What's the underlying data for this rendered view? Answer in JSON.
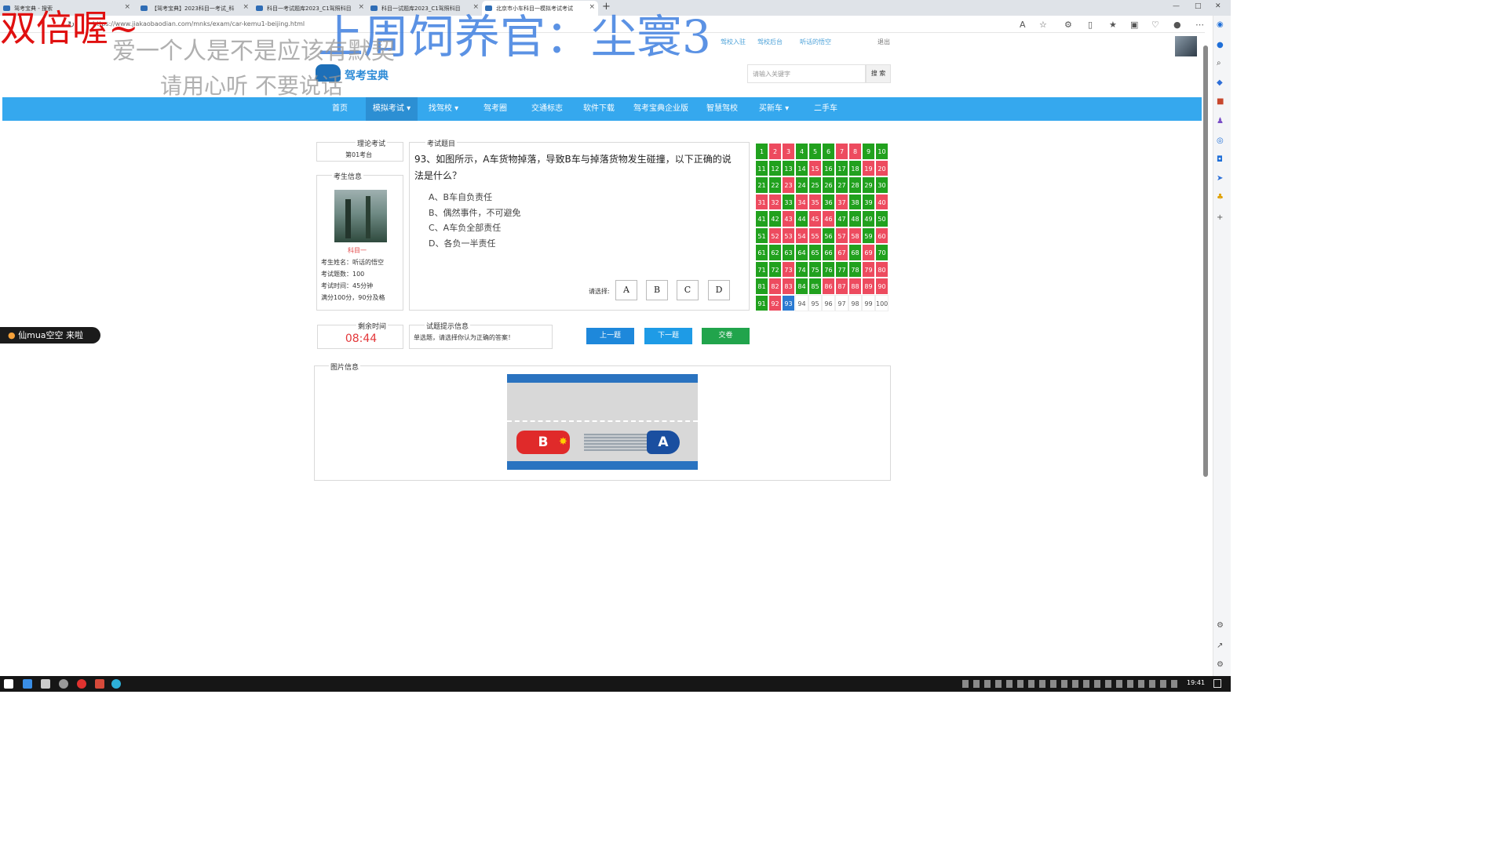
{
  "browser": {
    "tabs": [
      {
        "label": "驾考宝典 - 搜索"
      },
      {
        "label": "【驾考宝典】2023科目一考试_科"
      },
      {
        "label": "科目一考试题库2023_C1驾照科目"
      },
      {
        "label": "科目一试题库2023_C1驾照科目"
      },
      {
        "label": "北京市小车科目一模拟考试考试"
      }
    ],
    "url": "https://www.jiakaobaodian.com/mnks/exam/car-kemu1-beijing.html",
    "new_tab": "+"
  },
  "site": {
    "top_links": [
      "驾校入驻",
      "驾校后台",
      "听话的悟空"
    ],
    "logout": "退出",
    "logo": "驾考宝典",
    "search_placeholder": "请输入关键字",
    "search_button": "搜 索",
    "nav": [
      "首页",
      "模拟考试",
      "找驾校",
      "驾考圈",
      "交通标志",
      "软件下载",
      "驾考宝典企业版",
      "智慧驾校",
      "买新车",
      "二手车"
    ]
  },
  "exam": {
    "theory_legend": "理论考试",
    "seat": "第01考台",
    "info_legend": "考生信息",
    "subject": "科目一",
    "name": "考生姓名：听话的悟空",
    "count": "考试题数：100",
    "time": "考试时间：45分钟",
    "pass": "满分100分，90分及格",
    "question_legend": "考试题目",
    "question": "93、如图所示，A车货物掉落，导致B车与掉落货物发生碰撞，以下正确的说法是什么？",
    "options": [
      "A、B车自负责任",
      "B、偶然事件，不可避免",
      "C、A车负全部责任",
      "D、各负一半责任"
    ],
    "choose_label": "请选择:",
    "choices": [
      "A",
      "B",
      "C",
      "D"
    ],
    "timer_legend": "剩余时间",
    "timer": "08:44",
    "hint_legend": "试题提示信息",
    "hint": "单选题，请选择你认为正确的答案！",
    "prev": "上一题",
    "next": "下一题",
    "submit": "交卷",
    "picture_legend": "图片信息",
    "picture_labels": [
      "B",
      "A"
    ],
    "grid_status": "grrgggrrggggggrgggrrggrgggggggrrgrrgrggrggrgrrgggggrrrrgrrgrggggggrgrgggrgggggrrgrrggrrrrrgrbnnnnnnn"
  },
  "overlays": {
    "red": "双倍喔~",
    "blue": "上周饲养官：尘寰3",
    "grey1": "爱一个人是不是应该有默契",
    "grey2": "请用心听 不要说话",
    "live": "仙mua空空 来啦"
  },
  "taskbar": {
    "clock": "19:41"
  },
  "colors": {
    "nav": "#35a8ee",
    "correct": "#21a11e",
    "wrong": "#ed4b5f",
    "current": "#2b7ad1",
    "button_blue": "#1e88db",
    "button_green": "#21a44c"
  }
}
